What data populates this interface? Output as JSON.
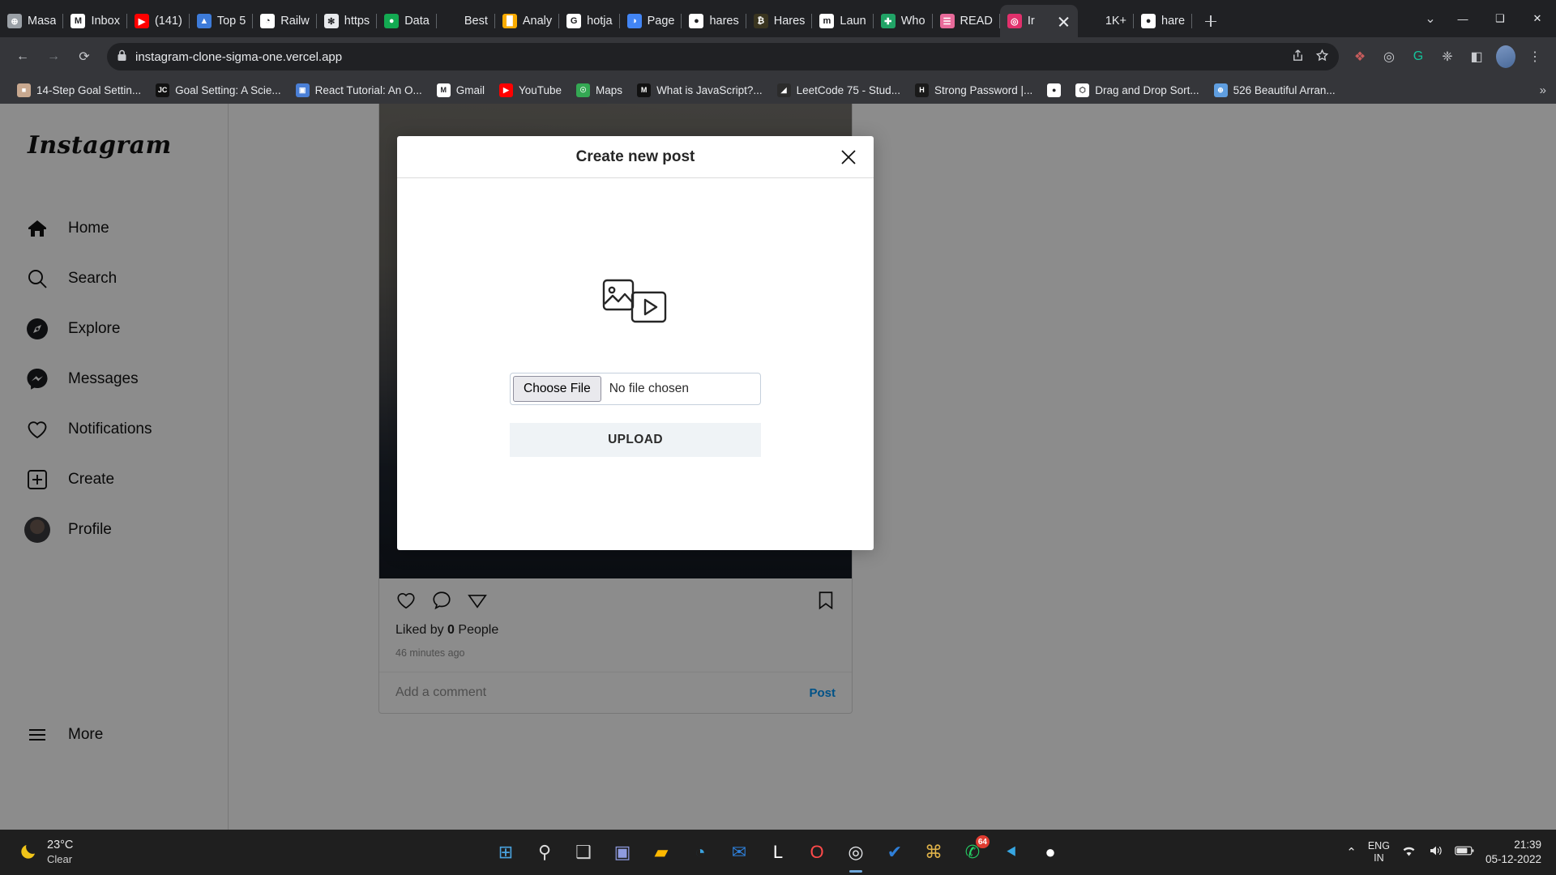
{
  "browser": {
    "tabs": [
      {
        "title": "Masa",
        "icon": "globe-icon",
        "color": "#9aa0a6",
        "glyph": "⊕"
      },
      {
        "title": "Inbox",
        "icon": "gmail-icon",
        "color": "#ffffff",
        "glyph": "M"
      },
      {
        "title": "(141)",
        "icon": "youtube-icon",
        "color": "#ff0000",
        "glyph": "▶"
      },
      {
        "title": "Top 5",
        "icon": "mountain-icon",
        "color": "#3d7bd9",
        "glyph": "▲"
      },
      {
        "title": "Railw",
        "icon": "railway-icon",
        "color": "#ffffff",
        "glyph": "◔"
      },
      {
        "title": "https",
        "icon": "dalle-icon",
        "color": "#e8eaed",
        "glyph": "✻"
      },
      {
        "title": "Data",
        "icon": "mongodb-icon",
        "color": "#13aa52",
        "glyph": "●"
      },
      {
        "title": "Best",
        "icon": "blank-icon",
        "color": "#5f6368",
        "glyph": ""
      },
      {
        "title": "Analy",
        "icon": "analytics-icon",
        "color": "#f9ab00",
        "glyph": "█"
      },
      {
        "title": "hotja",
        "icon": "google-icon",
        "color": "#ffffff",
        "glyph": "G"
      },
      {
        "title": "Page",
        "icon": "pagespeed-icon",
        "color": "#4285f4",
        "glyph": "◑"
      },
      {
        "title": "hares",
        "icon": "github-icon",
        "color": "#ffffff",
        "glyph": "●"
      },
      {
        "title": "Hares",
        "icon": "bitcoin-icon",
        "color": "#3a3520",
        "glyph": "₿"
      },
      {
        "title": "Laun",
        "icon": "medium-icon",
        "color": "#ffffff",
        "glyph": "m"
      },
      {
        "title": "Who",
        "icon": "plus-green-icon",
        "color": "#21a366",
        "glyph": "✚"
      },
      {
        "title": "READ",
        "icon": "book-icon",
        "color": "#e86a9a",
        "glyph": "☰"
      },
      {
        "title": "Ir",
        "icon": "instagram-icon",
        "color": "#e1306c",
        "glyph": "◎",
        "active": true
      },
      {
        "title": "1K+",
        "icon": "blank-icon",
        "color": "#5f6368",
        "glyph": ""
      },
      {
        "title": "hare",
        "icon": "github-icon",
        "color": "#ffffff",
        "glyph": "●"
      }
    ],
    "new_tab_label": "+",
    "window_controls": {
      "minimize": "—",
      "maximize": "❑",
      "close": "✕",
      "chevron": "⌄"
    },
    "nav": {
      "back": "←",
      "forward": "→",
      "reload": "⟳"
    },
    "omnibox": {
      "url": "instagram-clone-sigma-one.vercel.app",
      "lock_icon": "lock-icon",
      "share_icon": "share-icon",
      "star_icon": "star-icon"
    },
    "toolbar_icons": [
      {
        "name": "extension-colors-icon",
        "glyph": "❖",
        "color": "#c75c5c"
      },
      {
        "name": "shield-icon",
        "glyph": "◎",
        "color": "#c8cace"
      },
      {
        "name": "grammarly-icon",
        "glyph": "G",
        "color": "#15c39a"
      },
      {
        "name": "puzzle-extensions-icon",
        "glyph": "❈",
        "color": "#c8cace"
      },
      {
        "name": "sidepanel-icon",
        "glyph": "◧",
        "color": "#c8cace"
      },
      {
        "name": "profile-avatar-icon",
        "glyph": "",
        "color": "#7a96c2"
      },
      {
        "name": "more-menu-icon",
        "glyph": "⋮",
        "color": "#c8cace"
      }
    ],
    "bookmarks": [
      {
        "label": "14-Step Goal Settin...",
        "icon": "photo-icon",
        "color": "#c8a88f",
        "glyph": "■"
      },
      {
        "label": "Goal Setting: A Scie...",
        "icon": "jc-icon",
        "color": "#111111",
        "glyph": "JC"
      },
      {
        "label": "React Tutorial: An O...",
        "icon": "floppy-icon",
        "color": "#4a7fd6",
        "glyph": "▣"
      },
      {
        "label": "Gmail",
        "icon": "gmail-icon",
        "color": "#ffffff",
        "glyph": "M"
      },
      {
        "label": "YouTube",
        "icon": "youtube-icon",
        "color": "#ff0000",
        "glyph": "▶"
      },
      {
        "label": "Maps",
        "icon": "maps-icon",
        "color": "#34a853",
        "glyph": "☉"
      },
      {
        "label": "What is JavaScript?...",
        "icon": "mdn-icon",
        "color": "#111111",
        "glyph": "M"
      },
      {
        "label": "LeetCode 75 - Stud...",
        "icon": "leetcode-icon",
        "color": "#2b2b2b",
        "glyph": "◢"
      },
      {
        "label": "Strong Password |...",
        "icon": "hint-icon",
        "color": "#1a1a1a",
        "glyph": "H"
      },
      {
        "label": "",
        "icon": "github-icon",
        "color": "#ffffff",
        "glyph": "●"
      },
      {
        "label": "Drag and Drop Sort...",
        "icon": "codesandbox-icon",
        "color": "#ffffff",
        "glyph": "⬡"
      },
      {
        "label": "526 Beautiful Arran...",
        "icon": "globe-icon",
        "color": "#5f9ee0",
        "glyph": "⊕"
      }
    ],
    "bookmarks_overflow": "»"
  },
  "instagram": {
    "logo": "Instagram",
    "nav_items": [
      {
        "label": "Home",
        "icon": "home-icon"
      },
      {
        "label": "Search",
        "icon": "search-icon"
      },
      {
        "label": "Explore",
        "icon": "compass-icon"
      },
      {
        "label": "Messages",
        "icon": "messenger-icon"
      },
      {
        "label": "Notifications",
        "icon": "heart-icon"
      },
      {
        "label": "Create",
        "icon": "plus-square-icon"
      },
      {
        "label": "Profile",
        "icon": "profile-avatar-icon"
      }
    ],
    "more_label": "More",
    "post": {
      "like_icon": "heart-icon",
      "comment_icon": "comment-bubble-icon",
      "share_icon": "send-paperplane-icon",
      "save_icon": "bookmark-icon",
      "liked_by_prefix": "Liked by ",
      "liked_count": "0",
      "liked_by_suffix": " People",
      "timestamp": "46 minutes ago",
      "comment_placeholder": "Add a comment",
      "post_label": "Post"
    }
  },
  "modal": {
    "title": "Create new post",
    "close_icon": "close-icon",
    "media_icon": "photo-video-placeholder-icon",
    "choose_file_label": "Choose File",
    "file_status": "No file chosen",
    "upload_label": "UPLOAD"
  },
  "taskbar": {
    "weather": {
      "temp": "23°C",
      "condition": "Clear",
      "icon": "moon-icon"
    },
    "apps": [
      {
        "name": "start-windows-icon",
        "glyph": "⊞",
        "color": "#4aa3df"
      },
      {
        "name": "search-icon",
        "glyph": "⚲",
        "color": "#dcdcdc"
      },
      {
        "name": "task-view-icon",
        "glyph": "❑",
        "color": "#cfcfcf"
      },
      {
        "name": "teams-icon",
        "glyph": "▣",
        "color": "#8f9be0"
      },
      {
        "name": "file-explorer-icon",
        "glyph": "▰",
        "color": "#ffb900"
      },
      {
        "name": "microsoft-edge-icon",
        "glyph": "◔",
        "color": "#3ba3e0"
      },
      {
        "name": "mail-icon",
        "glyph": "✉",
        "color": "#2f7fd8"
      },
      {
        "name": "linkedin-icon",
        "glyph": "L",
        "color": "#ffffff"
      },
      {
        "name": "opera-icon",
        "glyph": "O",
        "color": "#ff4a4a"
      },
      {
        "name": "google-chrome-icon",
        "glyph": "◎",
        "color": "#e8eaed",
        "running": true
      },
      {
        "name": "todo-check-icon",
        "glyph": "✔",
        "color": "#2f7fd8"
      },
      {
        "name": "slack-icon",
        "glyph": "⌘",
        "color": "#e0b34a"
      },
      {
        "name": "whatsapp-icon",
        "glyph": "✆",
        "color": "#25d366",
        "badge": "64"
      },
      {
        "name": "vscode-icon",
        "glyph": "⯇",
        "color": "#37a7e3"
      },
      {
        "name": "github-desktop-icon",
        "glyph": "●",
        "color": "#ffffff"
      }
    ],
    "tray": {
      "chevron": "⌃",
      "lang_line1": "ENG",
      "lang_line2": "IN",
      "wifi_icon": "wifi-icon",
      "volume_icon": "speaker-icon",
      "battery_icon": "battery-icon",
      "time": "21:39",
      "date": "05-12-2022"
    }
  }
}
